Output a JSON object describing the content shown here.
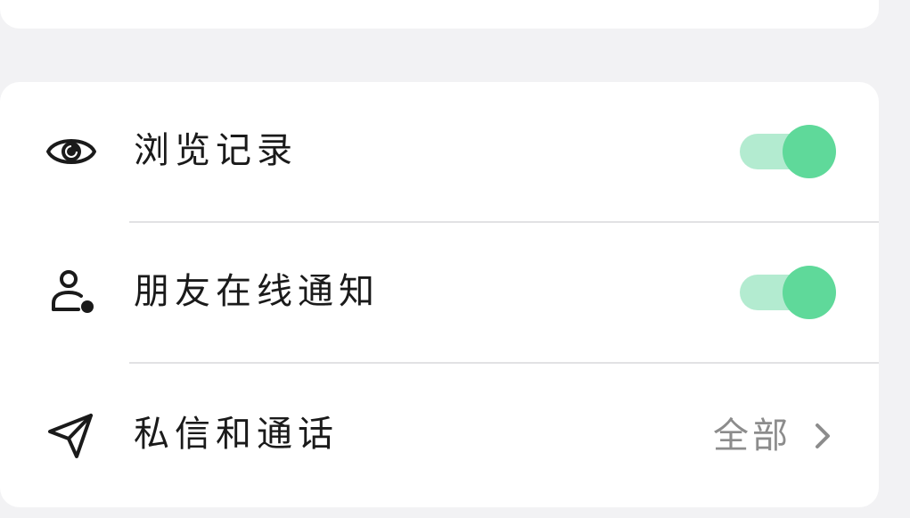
{
  "settings": {
    "items": [
      {
        "label": "浏览记录",
        "icon": "eye-icon",
        "control": "toggle",
        "enabled": true
      },
      {
        "label": "朋友在线通知",
        "icon": "user-status-icon",
        "control": "toggle",
        "enabled": true
      },
      {
        "label": "私信和通话",
        "icon": "send-icon",
        "control": "disclosure",
        "value": "全部"
      }
    ]
  },
  "colors": {
    "background": "#f2f2f4",
    "card": "#ffffff",
    "toggle_on_track": "#b3ebd0",
    "toggle_on_knob": "#5fd99a",
    "label_text": "#1a1a1a",
    "value_text": "#8c8c8c",
    "divider": "#e2e2e4"
  }
}
